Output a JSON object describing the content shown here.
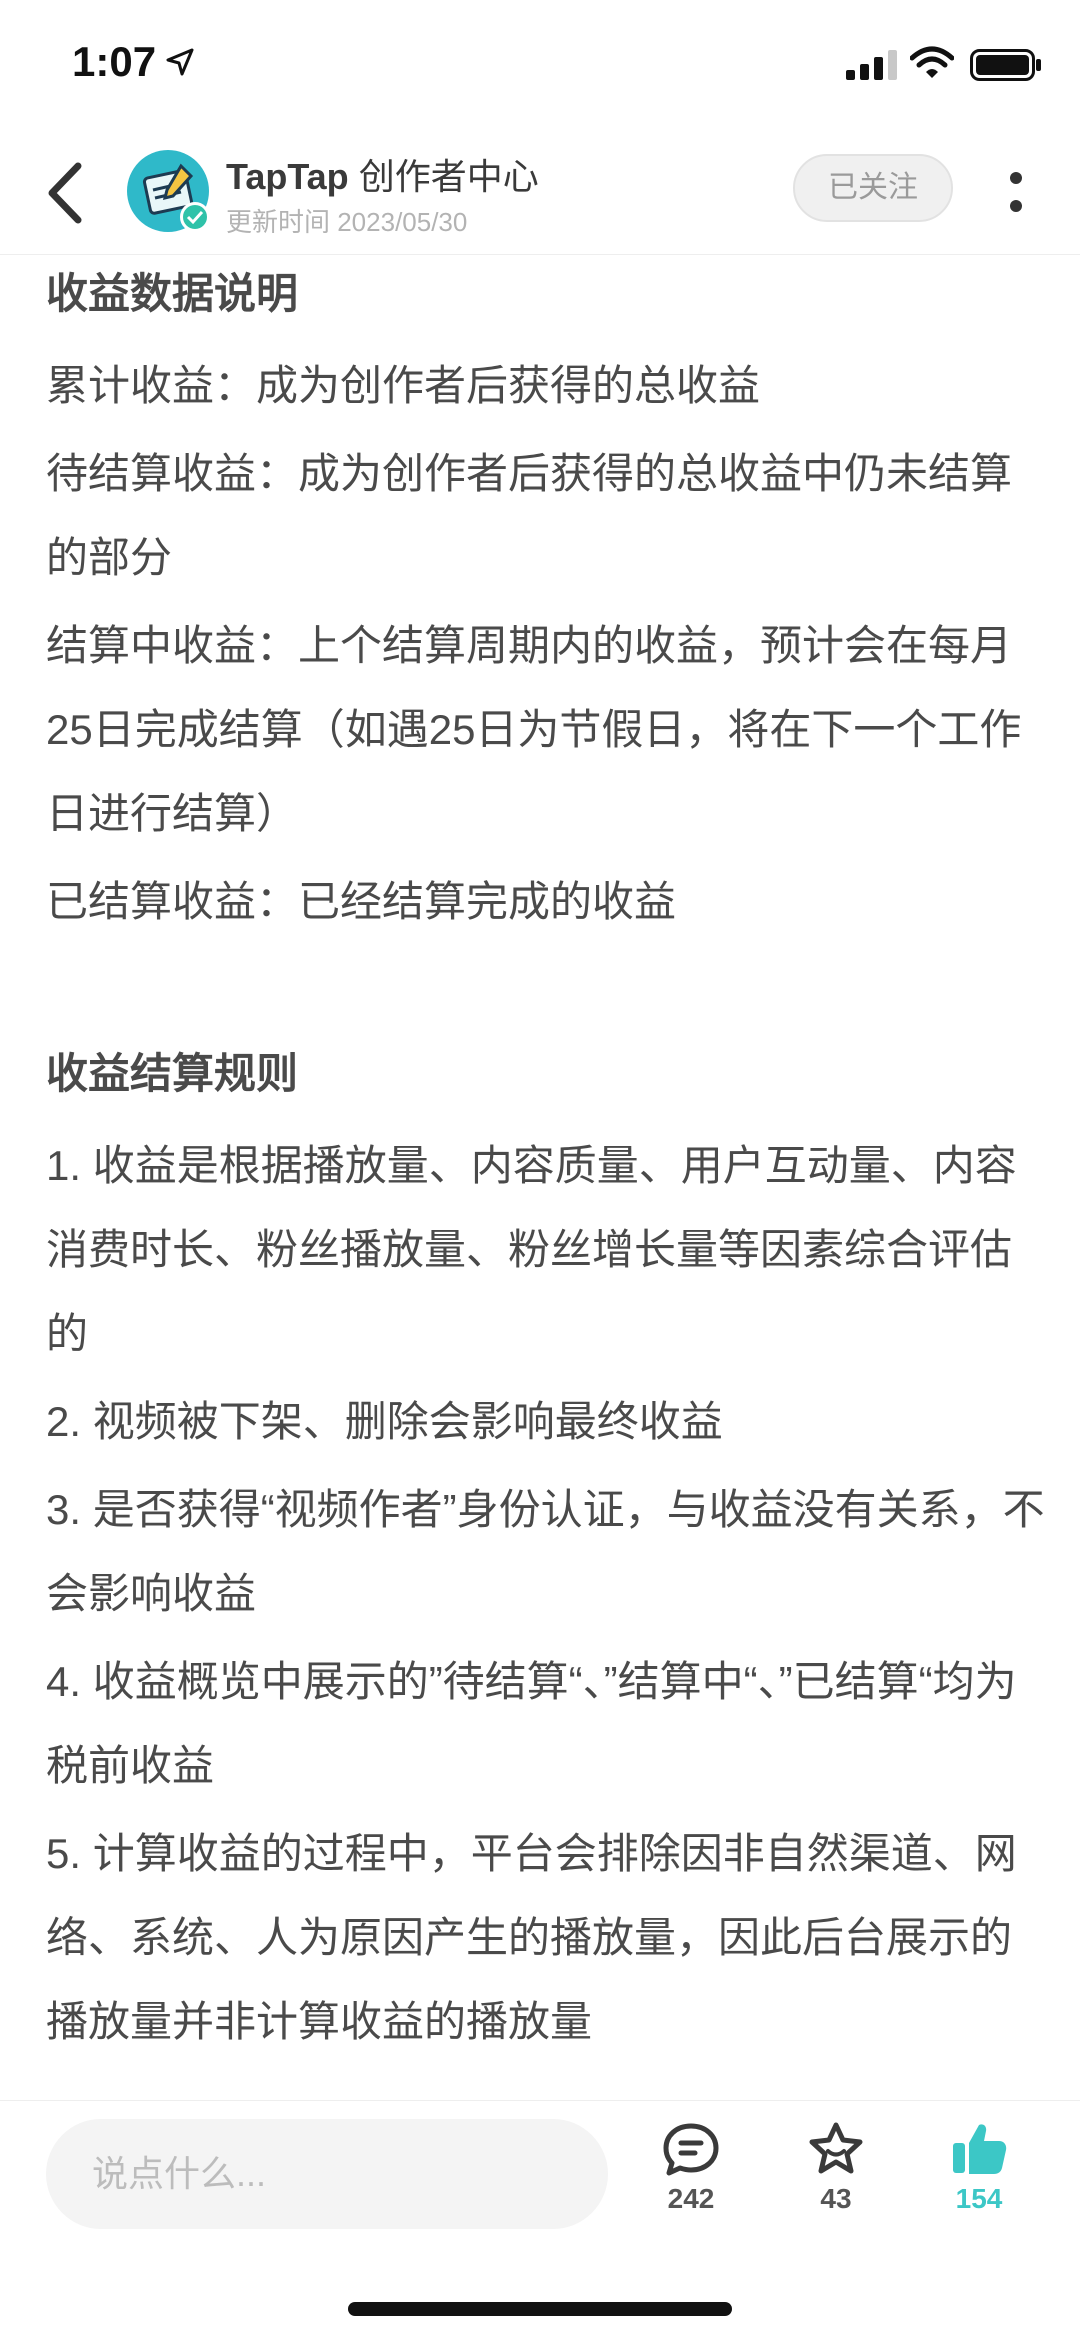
{
  "status_bar": {
    "time": "1:07"
  },
  "header": {
    "account_name_latin": "TapTap",
    "account_name_cn": "创作者中心",
    "updated": "更新时间 2023/05/30",
    "follow_label": "已关注"
  },
  "content": {
    "section1_title": "收益数据说明",
    "section1_items": [
      "累计收益：成为创作者后获得的总收益",
      "待结算收益：成为创作者后获得的总收益中仍未结算的部分",
      "结算中收益：上个结算周期内的收益，预计会在每月25日完成结算（如遇25日为节假日，将在下一个工作日进行结算）",
      "已结算收益：已经结算完成的收益"
    ],
    "section2_title": "收益结算规则",
    "section2_items": [
      "1. 收益是根据播放量、内容质量、用户互动量、内容消费时长、粉丝播放量、粉丝增长量等因素综合评估的",
      "2. 视频被下架、删除会影响最终收益",
      "3. 是否获得“视频作者”身份认证，与收益没有关系，不会影响收益",
      "4. 收益概览中展示的”待结算“、”结算中“、”已结算“均为税前收益",
      "5. 计算收益的过程中，平台会排除因非自然渠道、网络、系统、人为原因产生的播放量，因此后台展示的播放量并非计算收益的播放量"
    ]
  },
  "bottom_bar": {
    "comment_placeholder": "说点什么...",
    "comment_count": "242",
    "favorite_count": "43",
    "like_count": "154"
  },
  "colors": {
    "accent": "#3cc7c6",
    "text": "#4a4a4a"
  }
}
